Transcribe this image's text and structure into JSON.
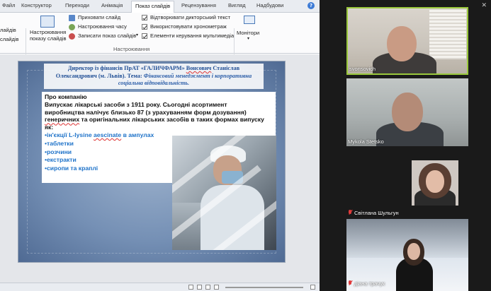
{
  "tabs": [
    "Файл",
    "Конструктор",
    "Переходи",
    "Анімація",
    "Показ слайдів",
    "Рецензування",
    "Вигляд",
    "Надбудови"
  ],
  "active_tab": "Показ слайдів",
  "ribbon": {
    "left_fragment_1": "лайдів",
    "left_fragment_2": "слайдів",
    "hide_slide": "Приховати слайд",
    "rehearse_timings": "Настроювання часу",
    "record_show": "Записати показ слайдів",
    "setup_show_line1": "Настроювання",
    "setup_show_line2": "показу слайдів",
    "play_narrations": "Відтворювати дикторський текст",
    "use_timings": "Використовувати хронометраж",
    "media_controls": "Елементи керування мультимедіа",
    "group_setup": "Настроювання",
    "monitors": "Монітори"
  },
  "slide": {
    "title_line1_a": "Директор із фінансів ПрАТ «ГАЛИЧФАРМ» ",
    "title_line1_name": "Вонсович",
    "title_line1_b": " Станіслав",
    "title_line2_a": "Олександрович (м. Львів). Тема: ",
    "title_line2_i": "Фінансовий менеджмент і корпоративна",
    "title_line3_i": "соціальна відповідальність.",
    "heading": "Про компанію",
    "line1": "Випускає лікарські засоби з 1911 року. Сьогодні асортимент",
    "line2": "виробництва налічує близько 87 (з урахуванням форм дозування)",
    "line3_a": "генеричних",
    "line3_b": " та оригінальних лікарських засобів в таких формах випуску",
    "line4": "як:",
    "item1_a": "•ін'єкції L-lysine ",
    "item1_b": "aescinate",
    "item1_c": " в ампулах",
    "item2": "•таблетки",
    "item3": "•розчини",
    "item4": "•екстракти",
    "item5": "•сиропи та  краплі"
  },
  "participants": [
    {
      "name": "svonsovich",
      "muted": false,
      "speaking": true
    },
    {
      "name": "Mykola Stetsko",
      "muted": false,
      "speaking": false
    },
    {
      "name": "Світлана Шульгун",
      "muted": true,
      "speaking": false
    },
    {
      "name": "діана трачук",
      "muted": true,
      "speaking": false
    }
  ],
  "colors": {
    "speaking_border": "#9ac83c",
    "muted_icon": "#e03a3a",
    "slide_title": "#1f4e95",
    "bullet_text": "#1f73c9"
  }
}
